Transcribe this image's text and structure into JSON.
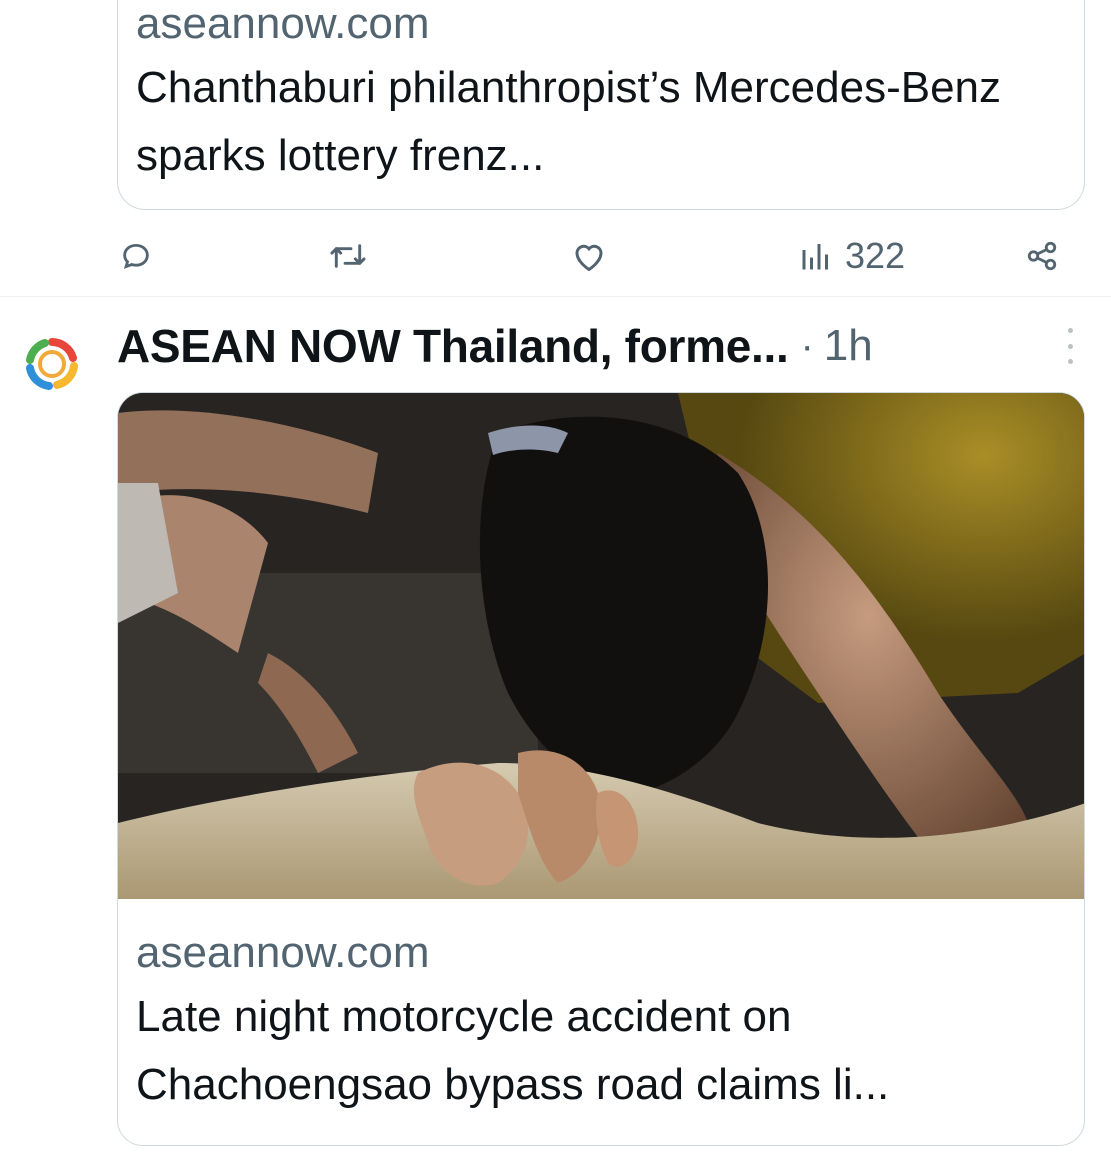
{
  "prev_tweet": {
    "card": {
      "domain": "aseannow.com",
      "headline": "Chanthaburi philanthropist’s Mercedes-Benz sparks lottery frenz..."
    },
    "actions": {
      "reply": {
        "icon": "reply-icon"
      },
      "retweet": {
        "icon": "retweet-icon"
      },
      "like": {
        "icon": "heart-icon"
      },
      "views": {
        "icon": "views-chart-icon",
        "count": "322"
      },
      "share": {
        "icon": "share-icon"
      }
    }
  },
  "tweet": {
    "author": "ASEAN NOW Thailand, forme...",
    "separator": "·",
    "time": "1h",
    "more_icon": "more-vertical-icon",
    "card": {
      "domain": "aseannow.com",
      "headline": "Late night motorcycle accident on Chachoengsao bypass road claims li..."
    }
  },
  "colors": {
    "text_primary": "#0f1419",
    "text_secondary": "#536471",
    "border": "#cfd9de",
    "avatar_ring": [
      "#e8463b",
      "#f5b82e",
      "#2f8fd8",
      "#4cae4f"
    ]
  }
}
